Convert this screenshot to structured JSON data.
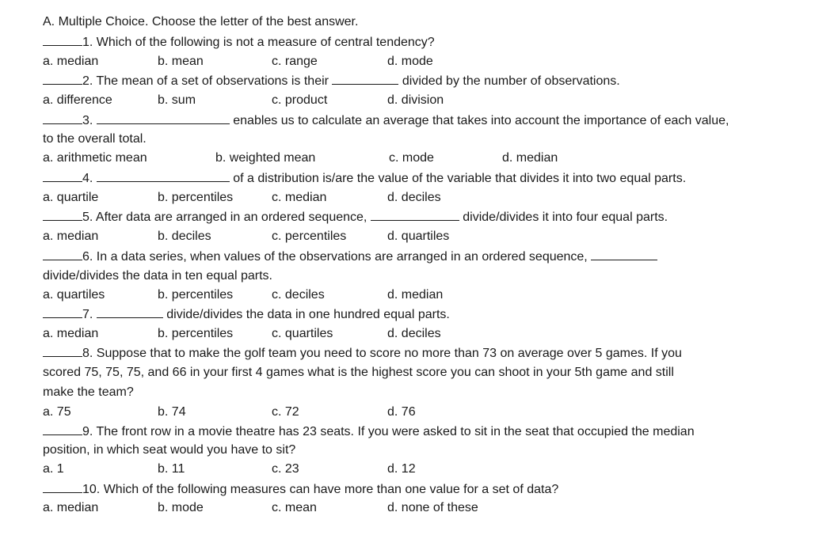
{
  "heading": "A. Multiple Choice. Choose the letter of the best answer.",
  "questions": [
    {
      "number": "1.",
      "text_before": "Which of the following is not a measure of central tendency?",
      "text_after": "",
      "options": [
        "a. median",
        "b. mean",
        "c. range",
        "d. mode"
      ]
    },
    {
      "number": "2.",
      "text_before": "The mean of a set of observations is their",
      "text_after": "divided by the number of observations.",
      "options": [
        "a. difference",
        "b. sum",
        "c. product",
        "d. division"
      ]
    },
    {
      "number": "3.",
      "text_before": "",
      "text_after": "enables us to calculate an average that takes into account the importance of each value,",
      "continuation": "to the overall total.",
      "options": [
        "a. arithmetic mean",
        "b. weighted mean",
        "c. mode",
        "d. median"
      ]
    },
    {
      "number": "4.",
      "text_before": "",
      "text_after": "of a distribution is/are the value of the variable that divides it into two equal parts.",
      "options": [
        "a. quartile",
        "b. percentiles",
        "c. median",
        "d. deciles"
      ]
    },
    {
      "number": "5.",
      "text_before": "After data are arranged in an ordered sequence,",
      "text_after": "divide/divides it into four equal parts.",
      "options": [
        "a. median",
        "b. deciles",
        "c. percentiles",
        "d. quartiles"
      ]
    },
    {
      "number": "6.",
      "text_before": "In a data series, when values of the observations are arranged in an ordered sequence,",
      "text_after": "",
      "continuation": "divide/divides the data in ten equal parts.",
      "options": [
        "a. quartiles",
        "b. percentiles",
        "c. deciles",
        "d. median"
      ]
    },
    {
      "number": "7.",
      "text_before": "",
      "text_after": "divide/divides the data in one hundred equal parts.",
      "options": [
        "a. median",
        "b. percentiles",
        "c. quartiles",
        "d. deciles"
      ]
    },
    {
      "number": "8.",
      "text_before": "Suppose that to make the golf team you need to score no more than 73 on average over 5 games. If you",
      "continuation": "scored 75, 75, 75, and 66 in your first 4 games what is the highest score you can shoot in your 5th game and still",
      "continuation2": "make the team?",
      "options": [
        "a. 75",
        "b. 74",
        "c. 72",
        "d. 76"
      ]
    },
    {
      "number": "9.",
      "text_before": "The front row in a movie theatre has 23 seats. If you were asked to sit in the seat that occupied the median",
      "continuation": "position, in which seat would you have to sit?",
      "options": [
        "a. 1",
        "b. 11",
        "c. 23",
        "d. 12"
      ]
    },
    {
      "number": "10.",
      "text_before": "Which of the following measures can have more than one value for a set of data?",
      "options": [
        "a. median",
        "b. mode",
        "c. mean",
        "d. none of these"
      ]
    }
  ]
}
